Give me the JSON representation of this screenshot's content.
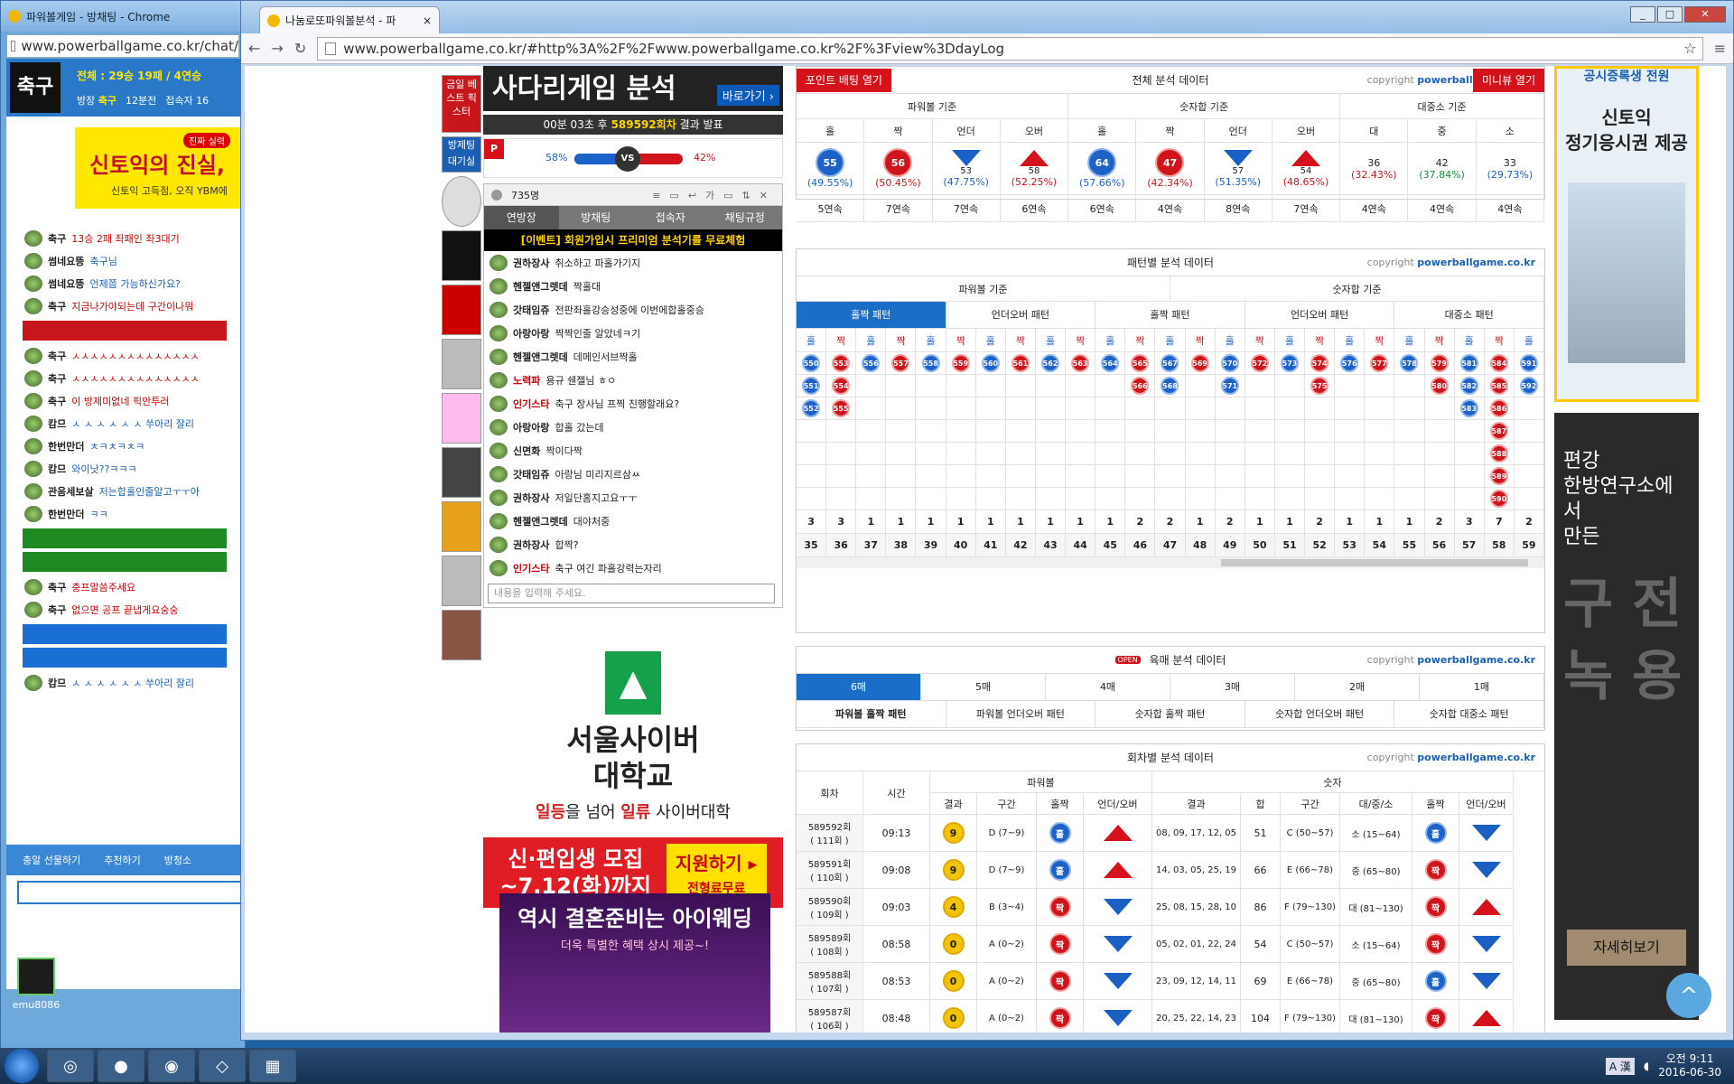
{
  "back_window": {
    "title": "파워볼게임 - 방채팅 - Chrome",
    "url": "www.powerballgame.co.kr/chat/",
    "room_badge": "축구",
    "stats": "전체 : 29승 19패 / 4연승",
    "owner_label": "방장",
    "owner_name": "축구",
    "minutes": "12분전",
    "visitors_label": "접속자 16",
    "ad_banner": "신토익의 진실,",
    "ad_tag": "진짜 실력",
    "ad_sub": "신토익 고득점, 오직 YBM에",
    "chat": [
      {
        "name": "축구",
        "msg": "13승 2패 좌패인 좌3대기"
      },
      {
        "name": "썸네요뜽",
        "msg": "축구님"
      },
      {
        "name": "썸네요뜽",
        "msg": "언제쯤 가능하신가요?"
      },
      {
        "name": "축구",
        "msg": "지금나가야되는데 구간이나뭐"
      },
      {
        "name": "축구",
        "msg": "ㅅㅅㅅㅅㅅㅅㅅㅅㅅㅅㅅㅅㅅㅅ"
      },
      {
        "name": "축구",
        "msg": "ㅅㅅㅅㅅㅅㅅㅅㅅㅅㅅㅅㅅㅅㅅ"
      },
      {
        "name": "축구",
        "msg": "이 방제미없네 픽안투러"
      },
      {
        "name": "캄므",
        "msg": "ㅅ ㅅ ㅅ ㅅ ㅅ ㅅ 쑤아리 잘리"
      },
      {
        "name": "한번만더",
        "msg": "ㅊㅋㅊㅋㅊㅋ"
      },
      {
        "name": "캄므",
        "msg": "와이낫??ㅋㅋㅋ"
      },
      {
        "name": "관음세보살",
        "msg": "저는합홀인줄알고ㅜㅜ아"
      },
      {
        "name": "한번만더",
        "msg": "ㅋㅋ"
      },
      {
        "name": "축구",
        "msg": "충프말씀주세요"
      },
      {
        "name": "축구",
        "msg": "없으면 공프 끝냅게요숭숭"
      },
      {
        "name": "캄므",
        "msg": "ㅅ ㅅ ㅅ ㅅ ㅅ ㅅ 쑤아리 잘리"
      }
    ],
    "footer_links": [
      "충알 선물하기",
      "추천하기",
      "방청소"
    ]
  },
  "front_window": {
    "tab_title": "나눔로또파워볼분석 - 파",
    "tab_close": "×",
    "url": "www.powerballgame.co.kr/#http%3A%2F%2Fwww.powerballgame.co.kr%2F%3Fview%3DdayLog",
    "back_icon": "←",
    "forward_icon": "→",
    "reload_icon": "↻",
    "star_icon": "☆",
    "menu_icon": "≡",
    "win_controls": [
      "_",
      "□",
      "✕"
    ]
  },
  "left_col": {
    "banner_title": "사다리게임 분석",
    "banner_go": "바로가기 ›",
    "countdown_pre": "00분 03초 후",
    "countdown_round": "589592회차",
    "countdown_post": "결과 발표",
    "blue_pct": "58%",
    "vs": "VS",
    "red_pct": "42%",
    "blue_share": 58,
    "side_buttons": [
      "금일 베스트 픽스터",
      "방제팅 대기실"
    ],
    "user_count": "735명",
    "chat_tabs": [
      "연방장",
      "방채팅",
      "접속자",
      "채팅규정"
    ],
    "event_text": "[이벤트] 회원가입시 프리미엄 분석기를 무료체험",
    "chat": [
      {
        "name": "권하장사",
        "msg": "취소하고 파홀가기지"
      },
      {
        "name": "헨젤앤그렛데",
        "msg": "짝홀대"
      },
      {
        "name": "갓태임쥬",
        "msg": "전판좌홀강승성중에 이번에합홀중승"
      },
      {
        "name": "아랑아랑",
        "msg": "짝짝인줄 알았네ㅋ기"
      },
      {
        "name": "헨젤앤그렛데",
        "msg": "데메인서브짝홀"
      },
      {
        "name": "노력파",
        "msg": "용규 쉔젤님 ㅎㅇ"
      },
      {
        "name": "인기스타",
        "msg": "축구 장사님 프찍 진행할래요?"
      },
      {
        "name": "아랑아랑",
        "msg": "합홀 갔는데"
      },
      {
        "name": "신면화",
        "msg": "짝이다짝"
      },
      {
        "name": "갓태임쥬",
        "msg": "아랑님 미리지르삼ㅆ"
      },
      {
        "name": "권하장사",
        "msg": "저일단홈지고요ㅜㅜ"
      },
      {
        "name": "헨젤앤그렛데",
        "msg": "대야처중"
      },
      {
        "name": "권하장사",
        "msg": "합짝?"
      },
      {
        "name": "인기스타",
        "msg": "축구 여긴 파홀강력는자리"
      }
    ],
    "chat_placeholder": "내용을 입력해 주세요.",
    "ad1_l1": "서울사이버",
    "ad1_l2": "대학교",
    "ad1_tag_a": "일등",
    "ad1_tag_b": "을 넘어 ",
    "ad1_tag_c": "일류",
    "ad1_tag_d": " 사이버대학",
    "ad1_band_a": "신·편입생 모집",
    "ad1_band_b": "~7.12(화)까지",
    "ad1_btn": "지원하기 ▸",
    "ad1_btn2": "전형료무료",
    "ad2_title": "역시 결혼준비는 아이웨딩",
    "ad2_sub": "더욱 특별한 혜택 상시 제공~!"
  },
  "right_ads": {
    "ad1_top": "공시증록생 전원",
    "ad1_l1": "신토익",
    "ad1_l2": "정기응시권 제공",
    "ad2_l1": "편강",
    "ad2_l2": "한방연구소에서",
    "ad2_l3": "만든",
    "ad2_big": "구 전 녹 용",
    "ad2_btn": "자세히보기",
    "top_btn": "^"
  },
  "total": {
    "title": "전체 분석 데이터",
    "copyright": "copyright",
    "brand": "powerballgame.co.kr",
    "btn_point": "포인트 배팅 열기",
    "btn_minimap": "미니뷰 열기",
    "groups": [
      "파워볼 기준",
      "숫자합 기준",
      "대중소 기준"
    ],
    "cols": [
      "홀",
      "짝",
      "언더",
      "오버",
      "홀",
      "짝",
      "언더",
      "오버",
      "대",
      "중",
      "소"
    ],
    "values": [
      "55",
      "56",
      "53",
      "58",
      "64",
      "47",
      "57",
      "54",
      "36",
      "42",
      "33"
    ],
    "pcts": [
      "(49.55%)",
      "(50.45%)",
      "(47.75%)",
      "(52.25%)",
      "(57.66%)",
      "(42.34%)",
      "(51.35%)",
      "(48.65%)",
      "(32.43%)",
      "(37.84%)",
      "(29.73%)"
    ],
    "streaks": [
      "5연속",
      "7연속",
      "7연속",
      "6연속",
      "6연속",
      "4연속",
      "8연속",
      "7연속",
      "4연속",
      "4연속",
      "4연속"
    ]
  },
  "pattern": {
    "title": "패턴별 분석 데이터",
    "groups": [
      "파워볼 기준",
      "숫자합 기준"
    ],
    "tabs": [
      "홀짝 패턴",
      "언더오버 패턴",
      "홀짝 패턴",
      "언더오버 패턴",
      "대중소 패턴"
    ],
    "heads": [
      "홀",
      "짝",
      "홀",
      "짝",
      "홀",
      "짝",
      "홀",
      "짝",
      "홀",
      "짝",
      "홀",
      "짝",
      "홀",
      "짝",
      "홀",
      "짝",
      "홀",
      "짝",
      "홀",
      "짝",
      "홀",
      "짝",
      "홀",
      "짝",
      "홀"
    ],
    "columns": [
      [
        "550",
        "551",
        "552"
      ],
      [
        "553",
        "554",
        "555"
      ],
      [
        "556"
      ],
      [
        "557"
      ],
      [
        "558"
      ],
      [
        "559"
      ],
      [
        "560"
      ],
      [
        "561"
      ],
      [
        "562"
      ],
      [
        "563"
      ],
      [
        "564"
      ],
      [
        "565",
        "566"
      ],
      [
        "567",
        "568"
      ],
      [
        "569"
      ],
      [
        "570",
        "571"
      ],
      [
        "572"
      ],
      [
        "573"
      ],
      [
        "574",
        "575"
      ],
      [
        "576"
      ],
      [
        "577"
      ],
      [
        "578"
      ],
      [
        "579",
        "580"
      ],
      [
        "581",
        "582",
        "583"
      ],
      [
        "584",
        "585",
        "586",
        "587",
        "588",
        "589",
        "590"
      ],
      [
        "591",
        "592"
      ]
    ],
    "counts": [
      "3",
      "3",
      "1",
      "1",
      "1",
      "1",
      "1",
      "1",
      "1",
      "1",
      "1",
      "2",
      "2",
      "1",
      "2",
      "1",
      "1",
      "2",
      "1",
      "1",
      "1",
      "2",
      "3",
      "7",
      "2"
    ],
    "indexes": [
      "35",
      "36",
      "37",
      "38",
      "39",
      "40",
      "41",
      "42",
      "43",
      "44",
      "45",
      "46",
      "47",
      "48",
      "49",
      "50",
      "51",
      "52",
      "53",
      "54",
      "55",
      "56",
      "57",
      "58",
      "59"
    ]
  },
  "six": {
    "badge": "OPEN",
    "title": "육매 분석 데이터",
    "tabs": [
      "6매",
      "5매",
      "4매",
      "3매",
      "2매",
      "1매"
    ],
    "subtabs": [
      "파워볼 홀짝 패턴",
      "파워볼 언더오버 패턴",
      "숫자합 홀짝 패턴",
      "숫자합 언더오버 패턴",
      "숫자합 대중소 패턴"
    ]
  },
  "rounds": {
    "title": "회차별 분석 데이터",
    "h_round": "회차",
    "h_time": "시간",
    "h_powerball": "파워볼",
    "h_number": "숫자",
    "sub": [
      "결과",
      "구간",
      "홀짝",
      "언더/오버",
      "결과",
      "합",
      "구간",
      "대/중/소",
      "홀짝",
      "언더/오버"
    ],
    "rows": [
      {
        "round": "589592회",
        "day": "( 111회 )",
        "time": "09:13",
        "pb": "9",
        "pbz": "D (7~9)",
        "pbo": "홀",
        "pbu": "up",
        "nums": "08, 09, 17, 12, 05",
        "sum": "51",
        "zone": "C (50~57)",
        "size": "소 (15~64)",
        "no": "홀",
        "nu": "down"
      },
      {
        "round": "589591회",
        "day": "( 110회 )",
        "time": "09:08",
        "pb": "9",
        "pbz": "D (7~9)",
        "pbo": "홀",
        "pbu": "up",
        "nums": "14, 03, 05, 25, 19",
        "sum": "66",
        "zone": "E (66~78)",
        "size": "중 (65~80)",
        "no": "짝",
        "nu": "down"
      },
      {
        "round": "589590회",
        "day": "( 109회 )",
        "time": "09:03",
        "pb": "4",
        "pbz": "B (3~4)",
        "pbo": "짝",
        "pbu": "down",
        "nums": "25, 08, 15, 28, 10",
        "sum": "86",
        "zone": "F (79~130)",
        "size": "대 (81~130)",
        "no": "짝",
        "nu": "up"
      },
      {
        "round": "589589회",
        "day": "( 108회 )",
        "time": "08:58",
        "pb": "0",
        "pbz": "A (0~2)",
        "pbo": "짝",
        "pbu": "down",
        "nums": "05, 02, 01, 22, 24",
        "sum": "54",
        "zone": "C (50~57)",
        "size": "소 (15~64)",
        "no": "짝",
        "nu": "down"
      },
      {
        "round": "589588회",
        "day": "( 107회 )",
        "time": "08:53",
        "pb": "0",
        "pbz": "A (0~2)",
        "pbo": "짝",
        "pbu": "down",
        "nums": "23, 09, 12, 14, 11",
        "sum": "69",
        "zone": "E (66~78)",
        "size": "중 (65~80)",
        "no": "홀",
        "nu": "down"
      },
      {
        "round": "589587회",
        "day": "( 106회 )",
        "time": "08:48",
        "pb": "0",
        "pbz": "A (0~2)",
        "pbo": "짝",
        "pbu": "down",
        "nums": "20, 25, 22, 14, 23",
        "sum": "104",
        "zone": "F (79~130)",
        "size": "대 (81~130)",
        "no": "짝",
        "nu": "up"
      }
    ]
  },
  "taskbar": {
    "apps": [
      "◎",
      "●",
      "◉",
      "◇",
      "▦"
    ],
    "clock_time": "오전 9:11",
    "clock_date": "2016-06-30",
    "ime": "A 漢"
  },
  "desktop_icon": "emu8086",
  "colors": {
    "blue": "#1c62c8",
    "red": "#d0141c",
    "accent": "#1a6ec8"
  }
}
